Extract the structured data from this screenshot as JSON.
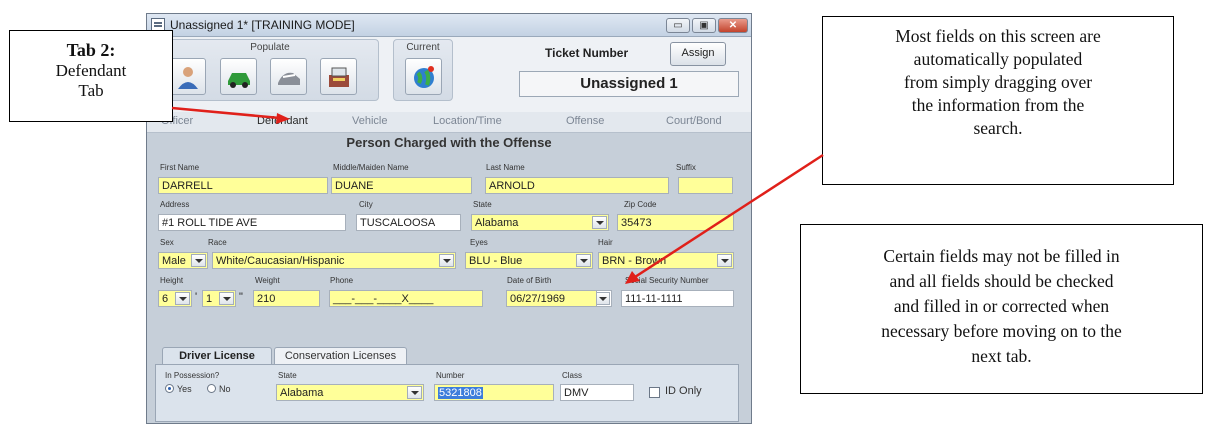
{
  "window": {
    "title": "Unassigned 1* [TRAINING MODE]",
    "minimize_glyph": "▭",
    "maximize_glyph": "▣",
    "close_glyph": "✕"
  },
  "toolbar": {
    "populate_label": "Populate",
    "current_label": "Current",
    "ticket_number_label": "Ticket Number",
    "assign_label": "Assign",
    "ticket_number_value": "Unassigned 1",
    "populate_icons": [
      "person-icon",
      "car-icon",
      "shoe-icon",
      "cash-register-icon"
    ],
    "current_icon": "globe-icon"
  },
  "tabs": [
    "Officer",
    "Defendant",
    "Vehicle",
    "Location/Time",
    "Offense",
    "Court/Bond"
  ],
  "active_tab": "Defendant",
  "section_title": "Person Charged with the Offense",
  "labels": {
    "first_name": "First Name",
    "middle_name": "Middle/Maiden Name",
    "last_name": "Last Name",
    "suffix": "Suffix",
    "address": "Address",
    "city": "City",
    "state": "State",
    "zip": "Zip Code",
    "sex": "Sex",
    "race": "Race",
    "eyes": "Eyes",
    "hair": "Hair",
    "height": "Height",
    "weight": "Weight",
    "phone": "Phone",
    "dob": "Date of Birth",
    "ssn": "Social Security Number"
  },
  "values": {
    "first_name": "DARRELL",
    "middle_name": "DUANE",
    "last_name": "ARNOLD",
    "suffix": "",
    "address": "#1 ROLL TIDE AVE",
    "city": "TUSCALOOSA",
    "state": "Alabama",
    "zip": "35473",
    "sex": "Male",
    "race": "White/Caucasian/Hispanic",
    "eyes": "BLU - Blue",
    "hair": "BRN - Brown",
    "height_ft": "6",
    "height_in": "1",
    "feet_mark": "'",
    "inch_mark": "\"",
    "weight": "210",
    "phone": "___-___-____X____",
    "dob": "06/27/1969",
    "ssn": "111-11-1111"
  },
  "subtabs": [
    "Driver License",
    "Conservation Licenses"
  ],
  "license": {
    "possession_label": "In Possession?",
    "yes_label": "Yes",
    "no_label": "No",
    "state_label": "State",
    "state_value": "Alabama",
    "number_label": "Number",
    "number_value": "5321808",
    "class_label": "Class",
    "class_value": "DMV",
    "id_only_label": "ID Only"
  },
  "callouts": {
    "tab2_title": "Tab 2:",
    "tab2_lines": [
      "Defendant",
      "Tab"
    ],
    "populated_lines": [
      "Most fields on this screen are",
      "automatically populated",
      "from simply dragging over",
      "the information from the",
      "search."
    ],
    "check_lines": [
      "Certain fields may not be filled in",
      "and all fields should be checked",
      "and filled in or corrected when",
      "necessary before moving on to the",
      "next tab."
    ]
  },
  "colors": {
    "required_field": "#ffff99",
    "arrow": "#e0201a"
  }
}
